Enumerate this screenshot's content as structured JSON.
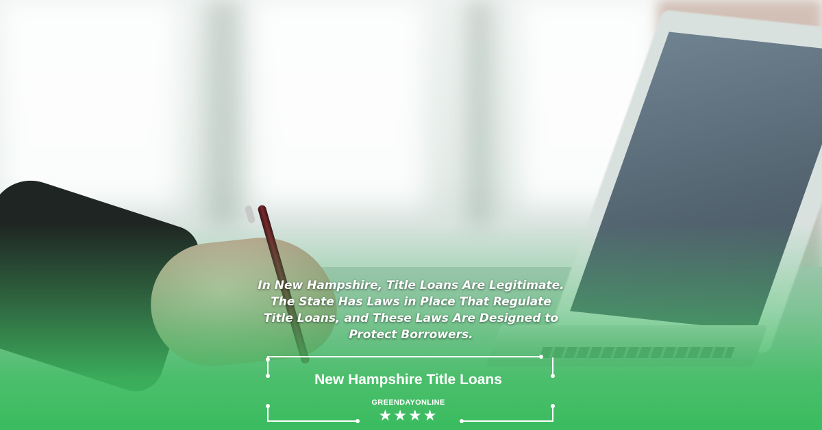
{
  "banner": {
    "caption": "In New Hampshire, Title Loans Are Legitimate. The State Has Laws in Place That Regulate Title Loans, and These Laws Are Designed to Protect Borrowers.",
    "title": "New Hampshire Title Loans",
    "brand": "GREENDAYONLINE",
    "rating": 4,
    "colors": {
      "accent_green": "#3ebc5f",
      "text": "#ffffff"
    }
  }
}
